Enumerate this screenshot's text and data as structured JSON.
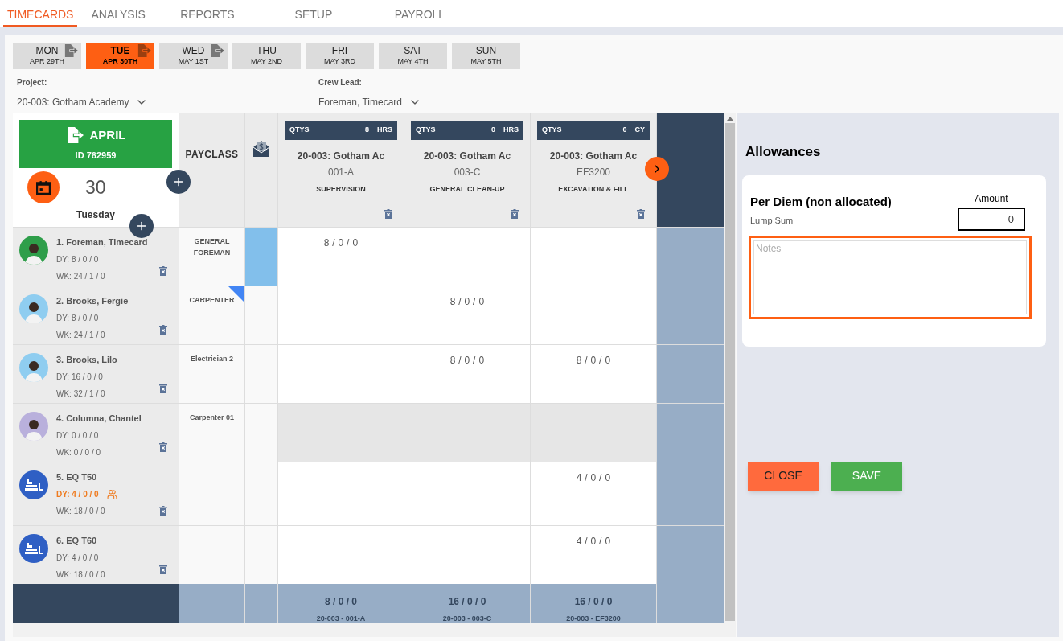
{
  "tabs": [
    {
      "label": "TIMECARDS",
      "selected": true
    },
    {
      "label": "ANALYSIS",
      "selected": false
    },
    {
      "label": "REPORTS",
      "selected": false
    },
    {
      "label": "SETUP",
      "selected": false
    },
    {
      "label": "PAYROLL",
      "selected": false
    }
  ],
  "days": [
    {
      "day": "MON",
      "date": "APR 29TH",
      "selected": false,
      "exported": true
    },
    {
      "day": "TUE",
      "date": "APR 30TH",
      "selected": true,
      "exported": true
    },
    {
      "day": "WED",
      "date": "MAY 1ST",
      "selected": false,
      "exported": true
    },
    {
      "day": "THU",
      "date": "MAY 2ND",
      "selected": false,
      "exported": false
    },
    {
      "day": "FRI",
      "date": "MAY 3RD",
      "selected": false,
      "exported": false
    },
    {
      "day": "SAT",
      "date": "MAY 4TH",
      "selected": false,
      "exported": false
    },
    {
      "day": "SUN",
      "date": "MAY 5TH",
      "selected": false,
      "exported": false
    }
  ],
  "project": {
    "label": "Project:",
    "value": "20-003: Gotham Academy"
  },
  "crew_lead": {
    "label": "Crew Lead:",
    "value": "Foreman, Timecard"
  },
  "date_card": {
    "month": "APRIL",
    "id": "ID 762959",
    "day_number": "30",
    "weekday": "Tuesday"
  },
  "payclass_header": "PAYCLASS",
  "jobs": [
    {
      "qty_label": "QTYS",
      "qty": "8",
      "unit": "HRS",
      "project": "20-003: Gotham Ac",
      "code": "001-A",
      "description": "SUPERVISION"
    },
    {
      "qty_label": "QTYS",
      "qty": "0",
      "unit": "HRS",
      "project": "20-003: Gotham Ac",
      "code": "003-C",
      "description": "GENERAL CLEAN-UP"
    },
    {
      "qty_label": "QTYS",
      "qty": "0",
      "unit": "CY",
      "project": "20-003: Gotham Ac",
      "code": "EF3200",
      "description": "EXCAVATION & FILL"
    }
  ],
  "rows": [
    {
      "kind": "person",
      "color": "#2e9e4a",
      "name": "1. Foreman, Timecard",
      "dy": "DY: 8 / 0 / 0",
      "dy_warning": false,
      "wk": "WK: 24 / 1 / 0",
      "payclass": "GENERAL FOREMAN",
      "payclass_flagged": false,
      "allowance_selected": true,
      "shaded": false,
      "cells": [
        "8 / 0 / 0",
        null,
        null
      ]
    },
    {
      "kind": "person",
      "color": "#8fcdf0",
      "name": "2. Brooks, Fergie",
      "dy": "DY: 8 / 0 / 0",
      "dy_warning": false,
      "wk": "WK: 24 / 1 / 0",
      "payclass": "CARPENTER",
      "payclass_flagged": true,
      "allowance_selected": false,
      "shaded": false,
      "cells": [
        null,
        "8 / 0 / 0",
        null
      ]
    },
    {
      "kind": "person",
      "color": "#8fcdf0",
      "name": "3. Brooks, Lilo",
      "dy": "DY: 16 / 0 / 0",
      "dy_warning": false,
      "wk": "WK: 32 / 1 / 0",
      "payclass": "Electrician 2",
      "payclass_flagged": false,
      "allowance_selected": false,
      "shaded": false,
      "cells": [
        null,
        "8 / 0 / 0",
        "8 / 0 / 0"
      ]
    },
    {
      "kind": "person",
      "color": "#b9b0dc",
      "name": "4. Columna, Chantel",
      "dy": "DY: 0 / 0 / 0",
      "dy_warning": false,
      "wk": "WK: 0 / 0 / 0",
      "payclass": "Carpenter 01",
      "payclass_flagged": false,
      "allowance_selected": false,
      "shaded": true,
      "cells": [
        null,
        null,
        null
      ]
    },
    {
      "kind": "equipment",
      "color": "#2f5fc4",
      "name": "5. EQ T50",
      "dy": "DY: 4 / 0 / 0",
      "dy_warning": true,
      "wk": "WK: 18 / 0 / 0",
      "payclass_flagged": false,
      "allowance_selected": false,
      "shaded": false,
      "cells": [
        null,
        null,
        "4 / 0 / 0"
      ]
    },
    {
      "kind": "equipment",
      "color": "#2f5fc4",
      "name": "6. EQ T60",
      "dy": "DY: 4 / 0 / 0",
      "dy_warning": false,
      "wk": "WK: 18 / 0 / 0",
      "payclass_flagged": false,
      "allowance_selected": false,
      "shaded": false,
      "cells": [
        null,
        null,
        "4 / 0 / 0"
      ]
    }
  ],
  "totals": [
    {
      "total": "8 / 0 / 0",
      "code": "20-003 - 001-A"
    },
    {
      "total": "16 / 0 / 0",
      "code": "20-003 - 003-C"
    },
    {
      "total": "16 / 0 / 0",
      "code": "20-003 - EF3200"
    }
  ],
  "allowances": {
    "title": "Allowances",
    "name": "Per Diem (non allocated)",
    "type": "Lump Sum",
    "amount_label": "Amount",
    "amount": "0",
    "notes_placeholder": "Notes"
  },
  "buttons": [
    {
      "kind": "close",
      "label": "CLOSE"
    },
    {
      "kind": "save",
      "label": "SAVE"
    }
  ]
}
